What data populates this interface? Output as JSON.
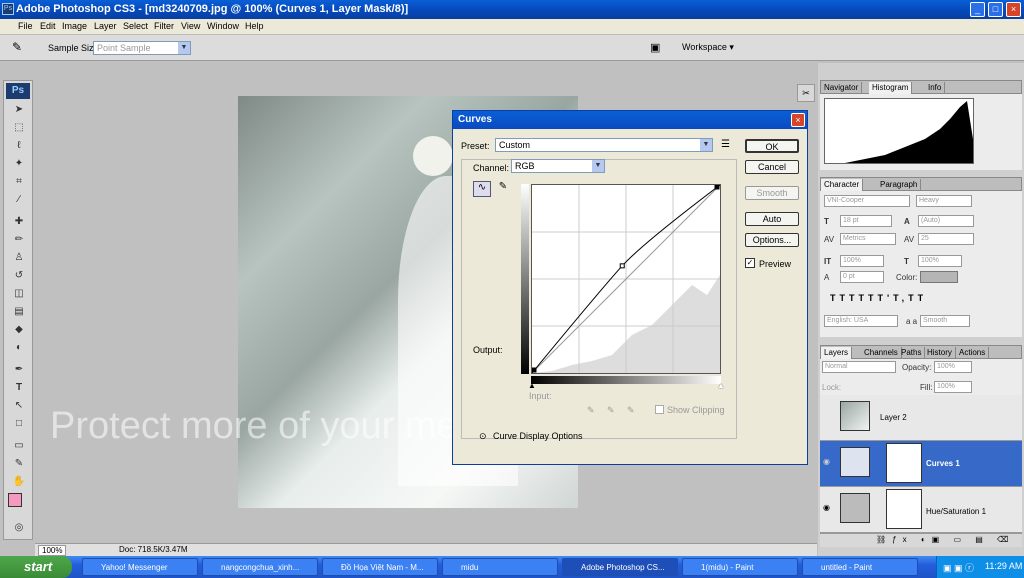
{
  "window": {
    "title": "Adobe Photoshop CS3 - [md3240709.jpg @ 100% (Curves 1, Layer Mask/8)]",
    "app_icon": "Ps"
  },
  "menu": [
    "File",
    "Edit",
    "Image",
    "Layer",
    "Select",
    "Filter",
    "View",
    "Window",
    "Help"
  ],
  "options": {
    "sample_size_label": "Sample Size:",
    "sample_size_value": "Point Sample",
    "workspace": "Workspace ▾"
  },
  "toolbox": {
    "logo": "Ps"
  },
  "status": {
    "zoom": "100%",
    "doc": "Doc: 718.5K/3.47M"
  },
  "curves": {
    "title": "Curves",
    "preset_label": "Preset:",
    "preset_value": "Custom",
    "channel_label": "Channel:",
    "channel_value": "RGB",
    "output_label": "Output:",
    "input_label": "Input:",
    "show_clipping": "Show Clipping",
    "display_options": "Curve Display Options",
    "buttons": {
      "ok": "OK",
      "cancel": "Cancel",
      "smooth": "Smooth",
      "auto": "Auto",
      "options": "Options..."
    },
    "preview": "Preview",
    "curve_points": [
      [
        0,
        0
      ],
      [
        0.48,
        0.57
      ],
      [
        1,
        1
      ]
    ]
  },
  "panels": {
    "nav_tabs": [
      "Navigator",
      "Histogram",
      "Info"
    ],
    "char_tabs": [
      "Character",
      "Paragraph"
    ],
    "font_family": "VNI-Cooper",
    "font_style": "Heavy",
    "font_size": "18 pt",
    "leading": "(Auto)",
    "kerning": "Metrics",
    "tracking": "25",
    "vscale": "100%",
    "hscale": "100%",
    "baseline": "0 pt",
    "color_label": "Color:",
    "language": "English: USA",
    "aa_label": "a a",
    "antialias": "Smooth",
    "layer_tabs": [
      "Layers",
      "Channels",
      "Paths",
      "History",
      "Actions"
    ],
    "blend_mode": "Normal",
    "opacity_label": "Opacity:",
    "opacity": "100%",
    "lock_label": "Lock:",
    "fill_label": "Fill:",
    "fill": "100%",
    "layers": [
      "Layer 2",
      "Curves 1",
      "Hue/Saturation 1"
    ]
  },
  "watermark": "Protect more of your memories for less!",
  "taskbar": {
    "start": "start",
    "items": [
      "Yahoo! Messenger",
      "nangcongchua_xinh...",
      "Đồ Họa Việt Nam - M...",
      "midu",
      "Adobe Photoshop CS...",
      "1(midu) - Paint",
      "untitled - Paint"
    ],
    "clock": "11:29 AM"
  }
}
